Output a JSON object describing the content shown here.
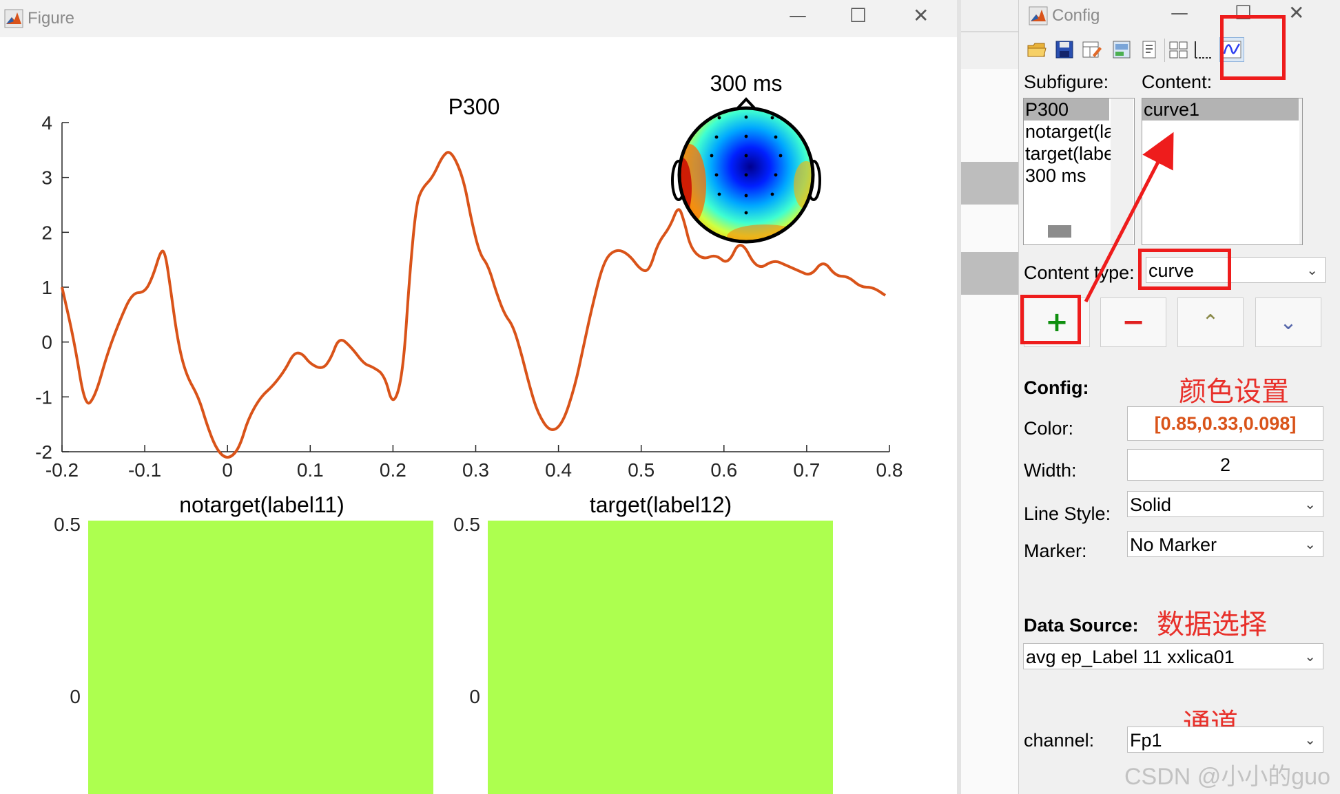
{
  "figure_window": {
    "title": "Figure",
    "controls": {
      "minimize": "—",
      "maximize": "☐",
      "close": "✕"
    }
  },
  "config_window": {
    "title": "Config",
    "controls": {
      "minimize": "—",
      "maximize": "☐",
      "close": "✕"
    },
    "toolbar": [
      "open-folder-icon",
      "save-icon",
      "edit-layout-icon",
      "print-preview-icon",
      "document-icon",
      "grid-layout-icon",
      "axes-icon",
      "curve-icon"
    ],
    "subfigure_label": "Subfigure:",
    "subfigures": [
      "P300",
      "notarget(la",
      "target(labe",
      "300 ms"
    ],
    "content_label": "Content:",
    "contents": [
      "curve1"
    ],
    "content_type_label": "Content type:",
    "content_type": "curve",
    "buttons": {
      "add": "+",
      "remove": "−",
      "up": "⌃",
      "down": "⌄"
    },
    "config_label": "Config:",
    "color_label": "Color:",
    "color_value": "[0.85,0.33,0.098]",
    "width_label": "Width:",
    "width_value": "2",
    "linestyle_label": "Line Style:",
    "linestyle_value": "Solid",
    "marker_label": "Marker:",
    "marker_value": "No Marker",
    "datasource_label": "Data Source:",
    "datasource_value": "avg ep_Label 11 xxlica01",
    "channel_label": "channel:",
    "channel_value": "Fp1"
  },
  "annotations": {
    "color_setting": "颜色设置",
    "data_selection": "数据选择",
    "channel": "通道"
  },
  "watermark": "CSDN @小小的guo",
  "colors": {
    "curve": "#d95319",
    "bar_fill": "#adff4f",
    "highlight": "#ee1c1c",
    "note": "#e8302a",
    "color_value_text": "#d95319"
  },
  "chart_data": [
    {
      "type": "line",
      "title": "P300",
      "xlim": [
        -0.2,
        0.8
      ],
      "ylim": [
        -2,
        4
      ],
      "xticks": [
        "-0.2",
        "-0.1",
        "0",
        "0.1",
        "0.2",
        "0.3",
        "0.4",
        "0.5",
        "0.6",
        "0.7",
        "0.8"
      ],
      "yticks": [
        "4",
        "3",
        "2",
        "1",
        "0",
        "-1",
        "-2"
      ],
      "series": [
        {
          "color": "#d95319",
          "x": [
            -0.2,
            -0.185,
            -0.172,
            -0.16,
            -0.145,
            -0.13,
            -0.115,
            -0.1,
            -0.09,
            -0.08,
            -0.075,
            -0.07,
            -0.06,
            -0.05,
            -0.035,
            -0.025,
            -0.015,
            -0.005,
            0.005,
            0.015,
            0.025,
            0.04,
            0.055,
            0.07,
            0.08,
            0.09,
            0.1,
            0.115,
            0.125,
            0.135,
            0.15,
            0.165,
            0.175,
            0.19,
            0.2,
            0.212,
            0.22,
            0.228,
            0.235,
            0.248,
            0.26,
            0.27,
            0.285,
            0.295,
            0.305,
            0.315,
            0.325,
            0.335,
            0.345,
            0.355,
            0.365,
            0.375,
            0.39,
            0.405,
            0.42,
            0.43,
            0.44,
            0.455,
            0.47,
            0.485,
            0.5,
            0.51,
            0.52,
            0.535,
            0.545,
            0.552,
            0.56,
            0.575,
            0.59,
            0.605,
            0.62,
            0.64,
            0.66,
            0.675,
            0.69,
            0.705,
            0.72,
            0.735,
            0.75,
            0.765,
            0.78,
            0.795
          ],
          "y": [
            1.0,
            0.0,
            -1.2,
            -1.0,
            -0.2,
            0.4,
            0.9,
            0.9,
            1.2,
            1.7,
            1.6,
            1.1,
            0.0,
            -0.6,
            -1.0,
            -1.5,
            -1.9,
            -2.1,
            -2.1,
            -1.9,
            -1.4,
            -1.0,
            -0.8,
            -0.5,
            -0.2,
            -0.2,
            -0.4,
            -0.5,
            -0.3,
            0.1,
            -0.1,
            -0.4,
            -0.45,
            -0.6,
            -1.2,
            -0.6,
            1.2,
            2.5,
            2.8,
            3.0,
            3.4,
            3.5,
            3.0,
            2.2,
            1.6,
            1.4,
            0.9,
            0.5,
            0.3,
            -0.2,
            -0.8,
            -1.3,
            -1.65,
            -1.5,
            -0.8,
            -0.1,
            0.6,
            1.5,
            1.7,
            1.6,
            1.3,
            1.3,
            1.8,
            2.1,
            2.5,
            2.2,
            1.7,
            1.5,
            1.6,
            1.4,
            1.9,
            1.3,
            1.5,
            1.4,
            1.3,
            1.2,
            1.5,
            1.2,
            1.2,
            1.0,
            1.0,
            0.85
          ]
        }
      ]
    },
    {
      "type": "heatmap",
      "title": "300 ms",
      "description_free": true
    },
    {
      "type": "bar",
      "title": "notarget(label11)",
      "yticks": [
        "0.5",
        "0"
      ],
      "ylim": [
        -0.5,
        0.5
      ],
      "color": "#adff4f"
    },
    {
      "type": "bar",
      "title": "target(label12)",
      "yticks": [
        "0.5",
        "0"
      ],
      "ylim": [
        -0.5,
        0.5
      ],
      "color": "#adff4f"
    }
  ]
}
